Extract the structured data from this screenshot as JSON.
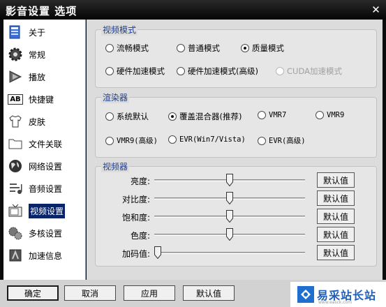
{
  "window": {
    "title": "影音设置 选项",
    "close_glyph": "✕"
  },
  "sidebar": {
    "items": [
      {
        "label": "关于",
        "icon": "info-icon"
      },
      {
        "label": "常规",
        "icon": "gear-icon"
      },
      {
        "label": "播放",
        "icon": "play-icon"
      },
      {
        "label": "快捷键",
        "icon": "keyboard-icon"
      },
      {
        "label": "皮肤",
        "icon": "shirt-icon"
      },
      {
        "label": "文件关联",
        "icon": "folder-icon"
      },
      {
        "label": "网络设置",
        "icon": "globe-icon"
      },
      {
        "label": "音频设置",
        "icon": "audio-icon"
      },
      {
        "label": "视频设置",
        "icon": "tv-icon"
      },
      {
        "label": "多核设置",
        "icon": "multicore-icon"
      },
      {
        "label": "加速信息",
        "icon": "accel-icon"
      }
    ],
    "selected": "视频设置",
    "ab_icon_text": "AB"
  },
  "video_mode": {
    "title": "视频模式",
    "options": [
      {
        "label": "流畅模式",
        "checked": false,
        "disabled": false
      },
      {
        "label": "普通模式",
        "checked": false,
        "disabled": false
      },
      {
        "label": "质量模式",
        "checked": true,
        "disabled": false
      },
      {
        "label": "硬件加速模式",
        "checked": false,
        "disabled": false
      },
      {
        "label": "硬件加速模式(高级)",
        "checked": false,
        "disabled": false
      },
      {
        "label": "CUDA加速模式",
        "checked": false,
        "disabled": true
      }
    ]
  },
  "renderer": {
    "title": "渲染器",
    "options": [
      {
        "label": "系统默认",
        "checked": false
      },
      {
        "label": "覆盖混合器(推荐)",
        "checked": true
      },
      {
        "label": "VMR7",
        "checked": false
      },
      {
        "label": "VMR9",
        "checked": false
      },
      {
        "label": "VMR9(高级)",
        "checked": false
      },
      {
        "label": "EVR(Win7/Vista)",
        "checked": false
      },
      {
        "label": "EVR(高级)",
        "checked": false
      }
    ]
  },
  "video": {
    "title": "视频器",
    "sliders": [
      {
        "label": "亮度:",
        "level": 0.5,
        "button": "默认值"
      },
      {
        "label": "对比度:",
        "level": 0.5,
        "button": "默认值"
      },
      {
        "label": "饱和度:",
        "level": 0.5,
        "button": "默认值"
      },
      {
        "label": "色度:",
        "level": 0.5,
        "button": "默认值"
      },
      {
        "label": "加码值:",
        "level": 0.0,
        "button": "默认值"
      }
    ]
  },
  "footer": {
    "buttons": [
      "确定",
      "取消",
      "应用",
      "默认值"
    ]
  },
  "watermark": {
    "text": "易采站长站",
    "sub": "www.easck.com"
  },
  "colors": {
    "selection": "#0a246a",
    "group_title": "#1f3f8c",
    "brand": "#1f6fd1"
  }
}
